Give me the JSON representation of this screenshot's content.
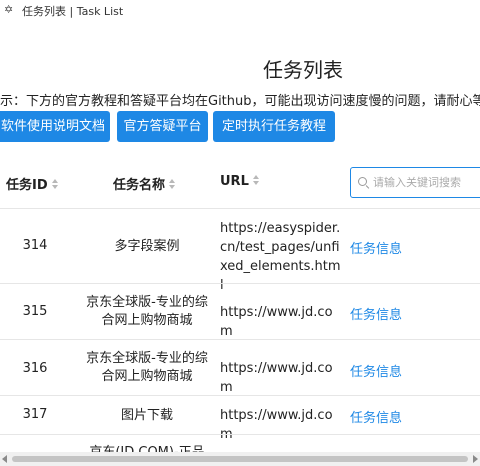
{
  "window": {
    "icon": "spider-icon",
    "title": "任务列表 | Task List"
  },
  "page": {
    "title": "任务列表",
    "notice": "示：下方的官方教程和答疑平台均在Github，可能出现访问速度慢的问题，请耐心等待"
  },
  "buttons": {
    "manual": "软件使用说明文档",
    "qa": "官方答疑平台",
    "schedule": "定时执行任务教程"
  },
  "table": {
    "headers": {
      "id": "任务ID",
      "name": "任务名称",
      "url": "URL"
    },
    "search_placeholder": "请输入关键词搜索",
    "rows": [
      {
        "id": "314",
        "name": "多字段案例",
        "url": "https://easyspider.cn/test_pages/unfixed_elements.html",
        "action": "任务信息"
      },
      {
        "id": "315",
        "name": "京东全球版-专业的综合网上购物商城",
        "url": "https://www.jd.com",
        "action": "任务信息"
      },
      {
        "id": "316",
        "name": "京东全球版-专业的综合网上购物商城",
        "url": "https://www.jd.com",
        "action": "任务信息"
      },
      {
        "id": "317",
        "name": "图片下载",
        "url": "https://www.jd.com",
        "action": "任务信息"
      },
      {
        "id": "",
        "name": "京东(JD.COM)-正品",
        "url": "",
        "action": ""
      }
    ]
  },
  "colors": {
    "accent": "#1e88e5",
    "text": "#222222",
    "divider": "#e6e6e6"
  }
}
